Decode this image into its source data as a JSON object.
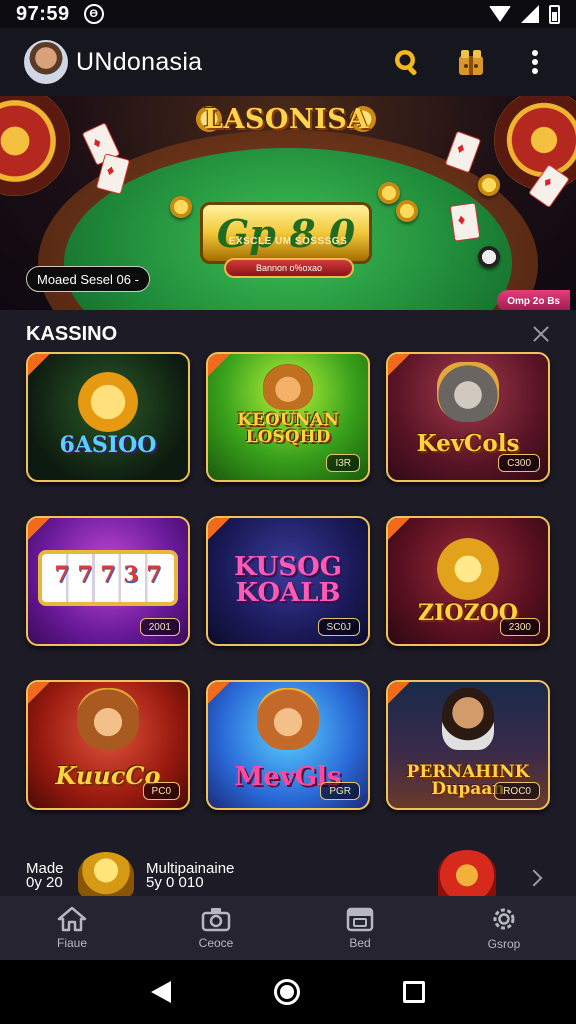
{
  "status_bar": {
    "time": "97:59",
    "notification_glyph": "Ɵ"
  },
  "app_bar": {
    "title": "UNdonasia",
    "icons": [
      "avatar",
      "search-icon",
      "gift-icon",
      "more-vert-icon"
    ]
  },
  "banner": {
    "brand": "LASONISA",
    "logo_text": "Gp 8 0",
    "subtitle": "EXSCLE UM SOSSSGS",
    "cta_label": "Bannon o%oxao",
    "left_chip": "Moaed Sesel 06 ‑",
    "right_chip": "Omp 2o Bs"
  },
  "section": {
    "title": "KASSINO",
    "tiles": [
      {
        "label": "6ASIOO",
        "tag": "",
        "theme": "green-dark"
      },
      {
        "label": "KEOUNAN LOSQHD",
        "tag": "I3R",
        "theme": "green"
      },
      {
        "label": "KevCols",
        "tag": "C300",
        "theme": "maroon"
      },
      {
        "label": "7 7 7 3 7",
        "tag": "2001",
        "theme": "purple"
      },
      {
        "label": "KUSOG KOALB",
        "tag": "SC0J",
        "theme": "navy"
      },
      {
        "label": "ZIOZOO",
        "tag": "2300",
        "theme": "maroon"
      },
      {
        "label": "KuucCo",
        "tag": "PC0",
        "theme": "red"
      },
      {
        "label": "MevGls",
        "tag": "PGR",
        "theme": "blue"
      },
      {
        "label": "PERNAHINK Dupaan",
        "tag": "ROC0",
        "theme": "night"
      }
    ]
  },
  "promo": {
    "left_line1": "Made",
    "left_line2": "0y 20",
    "mid_line1": "Multipainaine",
    "mid_line2": "5y 0 010"
  },
  "bottom_nav": [
    {
      "label": "Fiaue",
      "icon": "home-icon"
    },
    {
      "label": "Ceoce",
      "icon": "camera-icon"
    },
    {
      "label": "Bed",
      "icon": "calendar-icon"
    },
    {
      "label": "Gsrop",
      "icon": "settings-icon"
    }
  ],
  "colors": {
    "accent_gold": "#f1c25a",
    "background": "#1d1c26",
    "appbar": "#16161e",
    "nav": "#252430"
  }
}
